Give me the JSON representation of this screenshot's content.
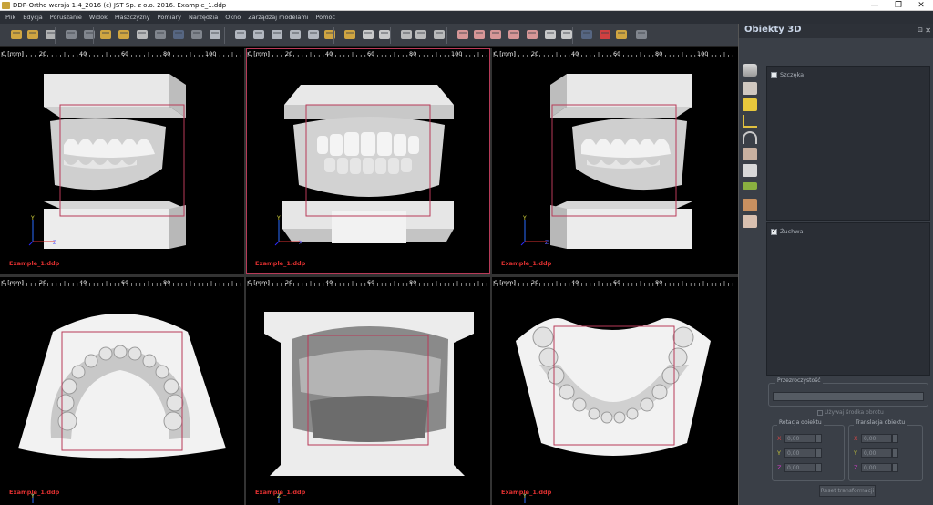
{
  "window": {
    "title": "DDP-Ortho wersja 1.4_2016 (c) JST Sp. z o.o. 2016. Example_1.ddp",
    "minimize": "—",
    "maximize": "❐",
    "close": "✕"
  },
  "menu": [
    "Plik",
    "Edycja",
    "Poruszanie",
    "Widok",
    "Płaszczyzny",
    "Pomiary",
    "Narzędzia",
    "Okno",
    "Zarządzaj modelami",
    "Pomoc"
  ],
  "toolbar": {
    "icons": [
      "open-folder-icon",
      "folder-icon",
      "save-icon",
      "undo-icon",
      "redo-icon",
      "rotate-icon",
      "pan-icon",
      "zoom-icon",
      "hand-icon",
      "select-icon",
      "cursor-icon",
      "layout-grid-icon",
      "layout-2-icon",
      "layout-3-icon",
      "layout-4-icon",
      "layout-5-icon",
      "layout-6-icon",
      "view-1-icon",
      "view-2-icon",
      "measure-icon",
      "ruler-icon",
      "model-view-1-icon",
      "model-view-2-icon",
      "model-view-3-icon",
      "arch-1-icon",
      "arch-2-icon",
      "arch-3-icon",
      "arch-4-icon",
      "arch-5-icon",
      "arch-6-icon",
      "arch-7-icon",
      "plane-icon",
      "move-cross-icon",
      "camera-icon",
      "settings-icon"
    ]
  },
  "viewports": [
    {
      "ruler_unit": "0 [mm]",
      "ticks": [
        "20",
        "40",
        "60",
        "80",
        "100"
      ],
      "filename": "Example_1.ddp",
      "axes": [
        "Y",
        "Z"
      ],
      "view": "right-lateral"
    },
    {
      "ruler_unit": "0 [mm]",
      "ticks": [
        "20",
        "40",
        "60",
        "80",
        "100"
      ],
      "filename": "Example_1.ddp",
      "axes": [
        "Y",
        "X"
      ],
      "view": "frontal"
    },
    {
      "ruler_unit": "0 [mm]",
      "ticks": [
        "20",
        "40",
        "60",
        "80",
        "100"
      ],
      "filename": "Example_1.ddp",
      "axes": [
        "Y",
        "Z"
      ],
      "view": "left-lateral"
    },
    {
      "ruler_unit": "0 [mm]",
      "ticks": [
        "20",
        "40",
        "60",
        "80"
      ],
      "filename": "Example_1.ddp",
      "axes": [
        "Y",
        "X"
      ],
      "view": "upper-occlusal"
    },
    {
      "ruler_unit": "0 [mm]",
      "ticks": [
        "20",
        "40",
        "60",
        "80"
      ],
      "filename": "Example_1.ddp",
      "axes": [
        "Z",
        "X"
      ],
      "view": "posterior"
    },
    {
      "ruler_unit": "0 [mm]",
      "ticks": [
        "20",
        "40",
        "60",
        "80"
      ],
      "filename": "Example_1.ddp",
      "axes": [
        "Y",
        "X"
      ],
      "view": "lower-occlusal"
    }
  ],
  "panel": {
    "title": "Obiekty 3D",
    "pin": "⊡",
    "close": "✕",
    "upper_object": "Szczęka",
    "lower_object": "Żuchwa",
    "transparency_label": "Przezroczystość",
    "use_center_label": "Używaj środka obrotu",
    "rotation_label": "Rotacja obiektu",
    "translation_label": "Translacja obiektu",
    "axes": [
      "X",
      "Y",
      "Z"
    ],
    "axis_colors": [
      "#d14646",
      "#c8c83c",
      "#d23cc8"
    ],
    "rotation_values": [
      "0,00",
      "0,00",
      "0,00"
    ],
    "translation_values": [
      "0,00",
      "0,00",
      "0,00"
    ],
    "reset_label": "Reset transformacji"
  }
}
